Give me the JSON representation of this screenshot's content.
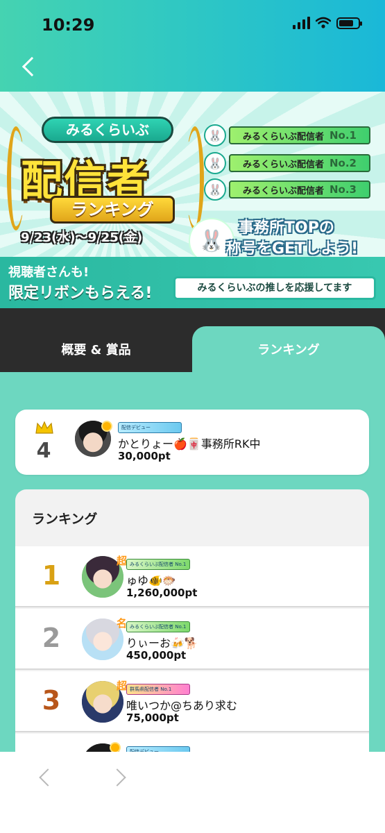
{
  "status_bar": {
    "time": "10:29"
  },
  "banner": {
    "brand": "みるくらいぶ",
    "title_main": "配信者",
    "title_sub": "ランキング",
    "dates": "9/23(水)～9/25(金)",
    "titles": [
      {
        "label": "みるくらいぶ配信者",
        "no": "No.1"
      },
      {
        "label": "みるくらいぶ配信者",
        "no": "No.2"
      },
      {
        "label": "みるくらいぶ配信者",
        "no": "No.3"
      }
    ],
    "cta_line1": "事務所TOPの",
    "cta_line2": "称号をGETしよう!",
    "viewer_line1": "視聴者さんも!",
    "viewer_line2": "限定リボンもらえる!",
    "support_text": "みるくらいぶの推しを応援してます"
  },
  "tabs": [
    {
      "label": "概要 & 賞品",
      "active": false
    },
    {
      "label": "ランキング",
      "active": true
    }
  ],
  "my_rank": {
    "rank": "4",
    "badge": "配信デビュー",
    "name": "かとりょー🍎🀄事務所RK中",
    "points": "30,000pt"
  },
  "ranking": {
    "header": "ランキング",
    "rows": [
      {
        "rank": "1",
        "rank_color": "#d9a114",
        "mark": "超",
        "badge": "みるくらいぶ配信者 No.1",
        "name": "ゅゆ🐠🐡",
        "points": "1,260,000pt"
      },
      {
        "rank": "2",
        "rank_color": "#9a9a9a",
        "mark": "名",
        "badge": "みるくらいぶ配信者 No.1",
        "name": "りぃーお🍻🐕",
        "points": "450,000pt"
      },
      {
        "rank": "3",
        "rank_color": "#b8561a",
        "mark": "超",
        "badge": "群馬県配信者 No.1",
        "name": "唯いつか@ちあり求む",
        "points": "75,000pt"
      },
      {
        "rank": "",
        "rank_color": "#9a9a9a",
        "mark": "",
        "badge": "配信デビュー",
        "name": "",
        "points": ""
      }
    ]
  },
  "colors": {
    "accent": "#6dd7c0",
    "header_start": "#45d3b1",
    "header_end": "#1ab8d8",
    "tab_bar": "#2c2c2c"
  }
}
